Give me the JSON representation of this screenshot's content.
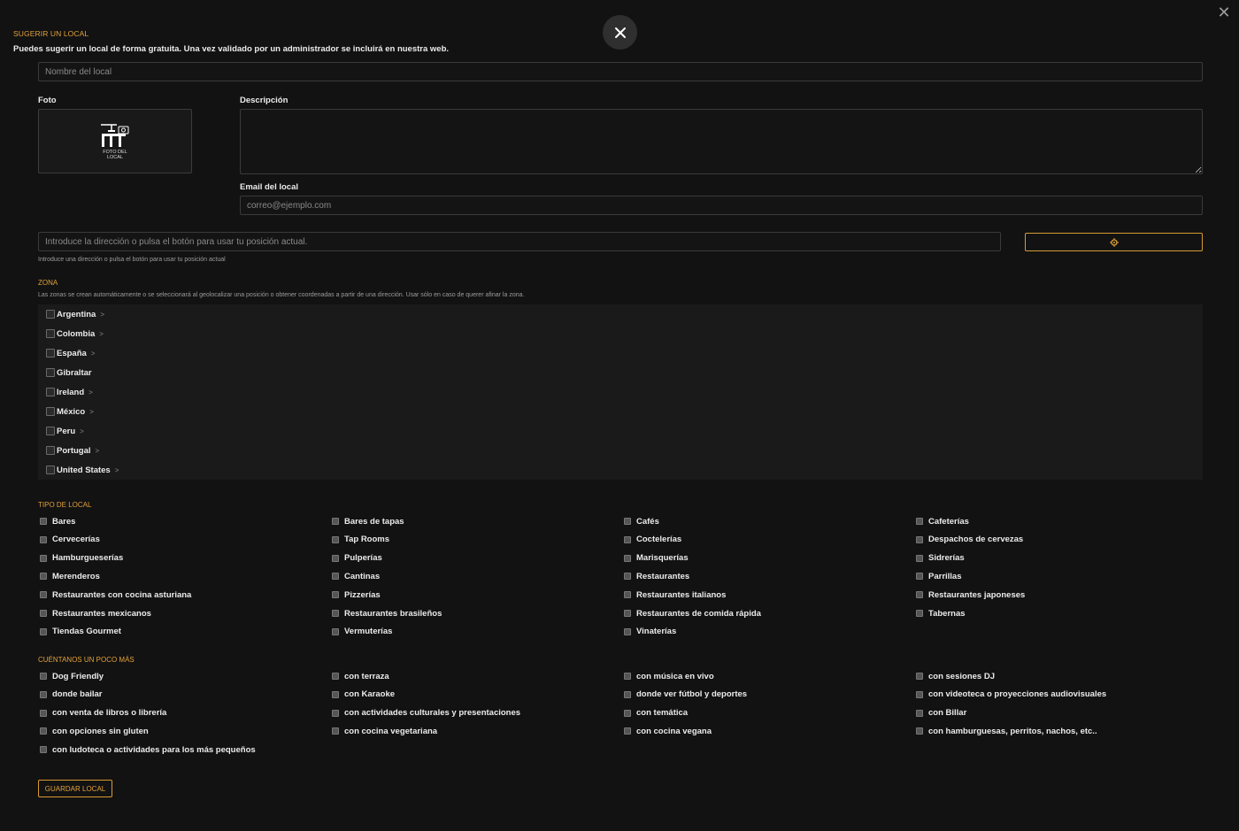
{
  "header": {
    "title": "SUGERIR UN LOCAL",
    "intro": "Puedes sugerir un local de forma gratuita. Una vez validado por un administrador se incluirá en nuestra web."
  },
  "form": {
    "name_placeholder": "Nombre del local",
    "photo_label": "Foto",
    "photo_caption": "FOTO DEL LOCAL",
    "description_label": "Descripción",
    "email_label": "Email del local",
    "email_placeholder": "correo@ejemplo.com",
    "address_placeholder": "Introduce la dirección o pulsa el botón para usar tu posición actual.",
    "address_help": "Introduce una dirección o pulsa el botón para usar tu posición actual",
    "save_label": "GUARDAR LOCAL"
  },
  "zones": {
    "title": "ZONA",
    "help": "Las zonas se crean automáticamente o se seleccionará al geolocalizar una posición o obtener coordenadas a partir de una dirección. Usar sólo en caso de querer afinar la zona.",
    "items": [
      {
        "label": "Argentina",
        "chevron": ">"
      },
      {
        "label": "Colombia",
        "chevron": ">"
      },
      {
        "label": "España",
        "chevron": ">"
      },
      {
        "label": "Gibraltar",
        "chevron": ""
      },
      {
        "label": "Ireland",
        "chevron": ">"
      },
      {
        "label": "México",
        "chevron": ">"
      },
      {
        "label": "Peru",
        "chevron": ">"
      },
      {
        "label": "Portugal",
        "chevron": ">"
      },
      {
        "label": "United States",
        "chevron": ">"
      }
    ]
  },
  "types": {
    "title": "TIPO DE LOCAL",
    "items": [
      "Bares",
      "Bares de tapas",
      "Cafés",
      "Cafeterías",
      "Cervecerías",
      "Tap Rooms",
      "Coctelerías",
      "Despachos de cervezas",
      "Hamburgueserías",
      "Pulperías",
      "Marisquerías",
      "Sidrerías",
      "Merenderos",
      "Cantinas",
      "Restaurantes",
      "Parrillas",
      "Restaurantes con cocina asturiana",
      "Pizzerías",
      "Restaurantes italianos",
      "Restaurantes japoneses",
      "Restaurantes mexicanos",
      "Restaurantes brasileños",
      "Restaurantes de comida rápida",
      "Tabernas",
      "Tiendas Gourmet",
      "Vermuterías",
      "Vinaterías"
    ]
  },
  "extras": {
    "title": "CUÉNTANOS UN POCO MÁS",
    "items": [
      "Dog Friendly",
      "con terraza",
      "con música en vivo",
      "con sesiones DJ",
      "donde bailar",
      "con Karaoke",
      "donde ver fútbol y deportes",
      "con videoteca o proyecciones audiovisuales",
      "con venta de libros o librería",
      "con actividades culturales y presentaciones",
      "con temática",
      "con Billar",
      "con opciones sin gluten",
      "con cocina vegetariana",
      "con cocina vegana",
      "con hamburguesas, perritos, nachos, etc..",
      "con ludoteca o actividades para los más pequeños"
    ]
  }
}
